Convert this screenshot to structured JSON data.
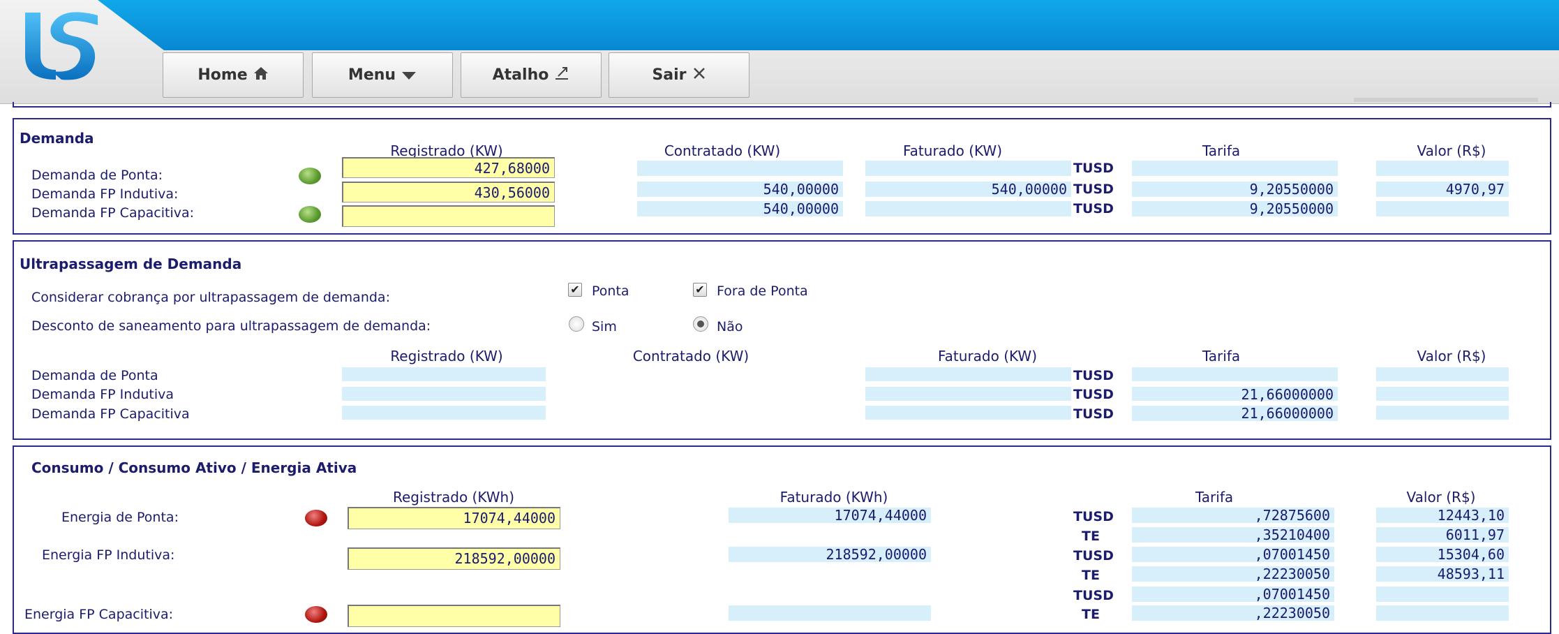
{
  "nav": {
    "home": "Home",
    "menu": "Menu",
    "atalho": "Atalho",
    "sair": "Sair",
    "icons": {
      "home": "home-icon",
      "menu": "caret-down-icon",
      "atalho": "external-link-icon",
      "sair": "close-icon"
    }
  },
  "demanda": {
    "title": "Demanda",
    "headers": {
      "registrado": "Registrado (KW)",
      "contratado": "Contratado (KW)",
      "faturado": "Faturado (KW)",
      "tarifa": "Tarifa",
      "valor": "Valor (R$)"
    },
    "rows": [
      {
        "label": "Demanda de Ponta:",
        "status": "green",
        "registrado": "427,68000",
        "contratado": "",
        "faturado": "",
        "code": "TUSD",
        "tarifa": "",
        "valor": ""
      },
      {
        "label": "Demanda FP Indutiva:",
        "status": "",
        "registrado": "430,56000",
        "contratado": "540,00000",
        "faturado": "540,00000",
        "code": "TUSD",
        "tarifa": "9,20550000",
        "valor": "4970,97"
      },
      {
        "label": "Demanda FP Capacitiva:",
        "status": "green",
        "registrado": "",
        "contratado": "540,00000",
        "faturado": "",
        "code": "TUSD",
        "tarifa": "9,20550000",
        "valor": ""
      }
    ]
  },
  "ultrapassagem": {
    "title": "Ultrapassagem de Demanda",
    "considerar_label": "Considerar cobrança por ultrapassagem de demanda:",
    "ponta_label": "Ponta",
    "fora_ponta_label": "Fora de Ponta",
    "ponta_checked": true,
    "fora_ponta_checked": true,
    "desconto_label": "Desconto de saneamento para ultrapassagem de demanda:",
    "sim_label": "Sim",
    "nao_label": "Não",
    "selected": "Não",
    "headers": {
      "registrado": "Registrado (KW)",
      "contratado": "Contratado (KW)",
      "faturado": "Faturado (KW)",
      "tarifa": "Tarifa",
      "valor": "Valor (R$)"
    },
    "rows": [
      {
        "label": "Demanda de Ponta",
        "registrado": "",
        "faturado": "",
        "code": "TUSD",
        "tarifa": "",
        "valor": ""
      },
      {
        "label": "Demanda FP Indutiva",
        "registrado": "",
        "faturado": "",
        "code": "TUSD",
        "tarifa": "21,66000000",
        "valor": ""
      },
      {
        "label": "Demanda FP Capacitiva",
        "registrado": "",
        "faturado": "",
        "code": "TUSD",
        "tarifa": "21,66000000",
        "valor": ""
      }
    ]
  },
  "consumo": {
    "title": "Consumo / Consumo Ativo / Energia Ativa",
    "headers": {
      "registrado": "Registrado (KWh)",
      "faturado": "Faturado (KWh)",
      "tarifa": "Tarifa",
      "valor": "Valor (R$)"
    },
    "rows": [
      {
        "label": "Energia de Ponta:",
        "status": "red",
        "registrado": "17074,44000",
        "faturado": "17074,44000",
        "tusd": {
          "code": "TUSD",
          "tarifa": ",72875600",
          "valor": "12443,10"
        },
        "te": {
          "code": "TE",
          "tarifa": ",35210400",
          "valor": "6011,97"
        }
      },
      {
        "label": "Energia FP Indutiva:",
        "status": "",
        "registrado": "218592,00000",
        "faturado": "218592,00000",
        "tusd": {
          "code": "TUSD",
          "tarifa": ",07001450",
          "valor": "15304,60"
        },
        "te": {
          "code": "TE",
          "tarifa": ",22230050",
          "valor": "48593,11"
        }
      },
      {
        "label": "Energia FP Capacitiva:",
        "status": "red",
        "registrado": "",
        "faturado": "",
        "tusd": {
          "code": "TUSD",
          "tarifa": ",07001450",
          "valor": ""
        },
        "te": {
          "code": "TE",
          "tarifa": ",22230050",
          "valor": ""
        }
      }
    ]
  }
}
